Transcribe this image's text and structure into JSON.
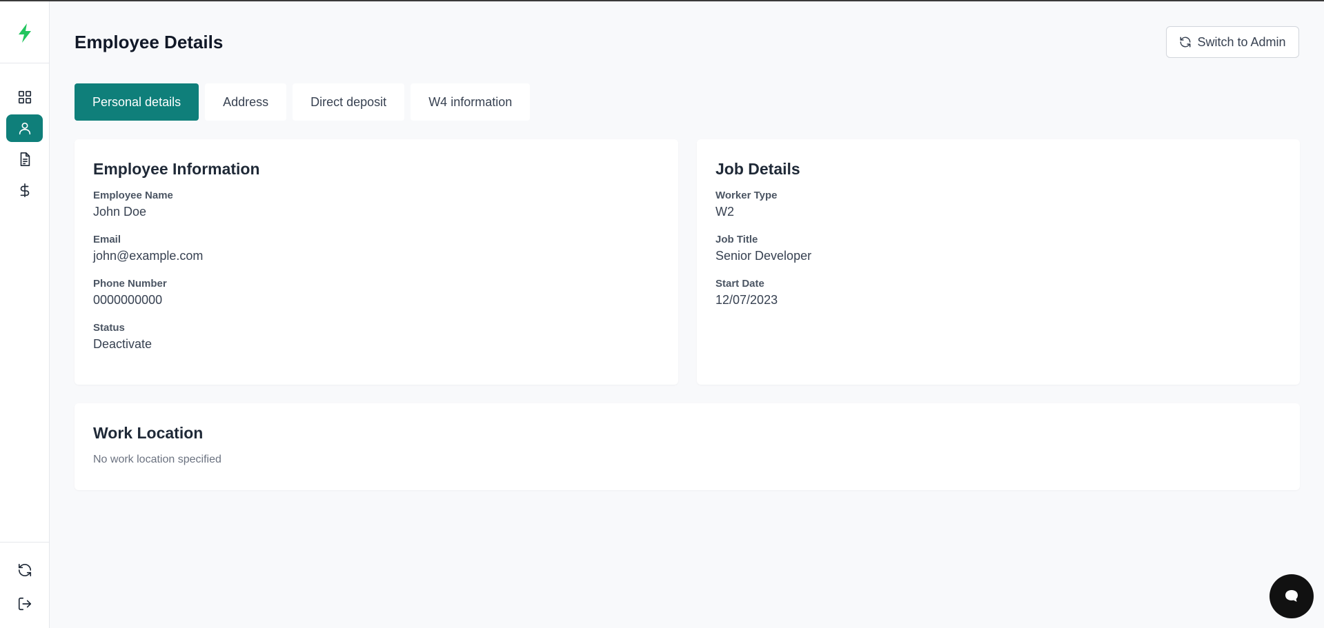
{
  "colors": {
    "accent": "#0f7f7a",
    "logo": "#22c55e",
    "background": "#f8f9fb"
  },
  "sidebar": {
    "logo_icon": "lightning-bolt-icon",
    "items": [
      {
        "name": "dashboard",
        "icon": "grid-icon",
        "active": false
      },
      {
        "name": "profile",
        "icon": "user-icon",
        "active": true
      },
      {
        "name": "documents",
        "icon": "document-icon",
        "active": false
      },
      {
        "name": "payroll",
        "icon": "dollar-icon",
        "active": false
      }
    ],
    "bottom_items": [
      {
        "name": "switch",
        "icon": "refresh-icon"
      },
      {
        "name": "logout",
        "icon": "logout-icon"
      }
    ]
  },
  "header": {
    "title": "Employee Details",
    "switch_button": {
      "label": "Switch to Admin",
      "icon": "refresh-icon"
    }
  },
  "tabs": [
    {
      "label": "Personal details",
      "active": true
    },
    {
      "label": "Address",
      "active": false
    },
    {
      "label": "Direct deposit",
      "active": false
    },
    {
      "label": "W4 information",
      "active": false
    }
  ],
  "employee_info": {
    "title": "Employee Information",
    "fields": [
      {
        "label": "Employee Name",
        "value": "John Doe"
      },
      {
        "label": "Email",
        "value": "john@example.com"
      },
      {
        "label": "Phone Number",
        "value": "0000000000"
      },
      {
        "label": "Status",
        "value": "Deactivate"
      }
    ]
  },
  "job_details": {
    "title": "Job Details",
    "fields": [
      {
        "label": "Worker Type",
        "value": "W2"
      },
      {
        "label": "Job Title",
        "value": "Senior Developer"
      },
      {
        "label": "Start Date",
        "value": "12/07/2023"
      }
    ]
  },
  "work_location": {
    "title": "Work Location",
    "empty_text": "No work location specified"
  },
  "chat": {
    "icon": "chat-bubble-icon"
  }
}
